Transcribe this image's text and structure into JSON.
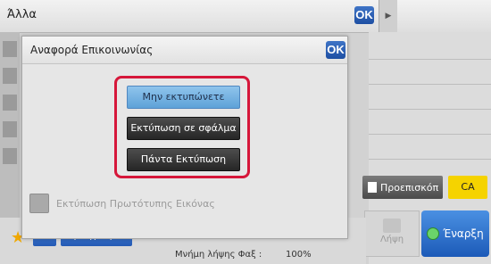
{
  "window": {
    "title": "Άλλα",
    "ok_label": "OK"
  },
  "right_panel": {
    "preview_label": "Προεπισκόπ",
    "ca_label": "CA",
    "capture_label": "Λήψη",
    "start_label": "Έναρξη"
  },
  "bottom_bar": {
    "previous_label": "Προηγούμεν",
    "memory_label": "Μνήμη λήψης Φαξ :",
    "memory_value": "100%"
  },
  "dialog": {
    "title": "Αναφορά Επικοινωνίας",
    "ok_label": "OK",
    "options": [
      {
        "label": "Μην εκτυπώνετε",
        "selected": true
      },
      {
        "label": "Εκτύπωση σε σφάλμα",
        "selected": false
      },
      {
        "label": "Πάντα Εκτύπωση",
        "selected": false
      }
    ],
    "checkbox_label": "Εκτύπωση Πρωτότυπης Εικόνας",
    "checkbox_checked": false
  },
  "colors": {
    "accent_blue": "#2a5fb0",
    "highlight_frame": "#d6173a",
    "ca_yellow": "#f5d300",
    "selected_option": "#7cb6e4"
  }
}
